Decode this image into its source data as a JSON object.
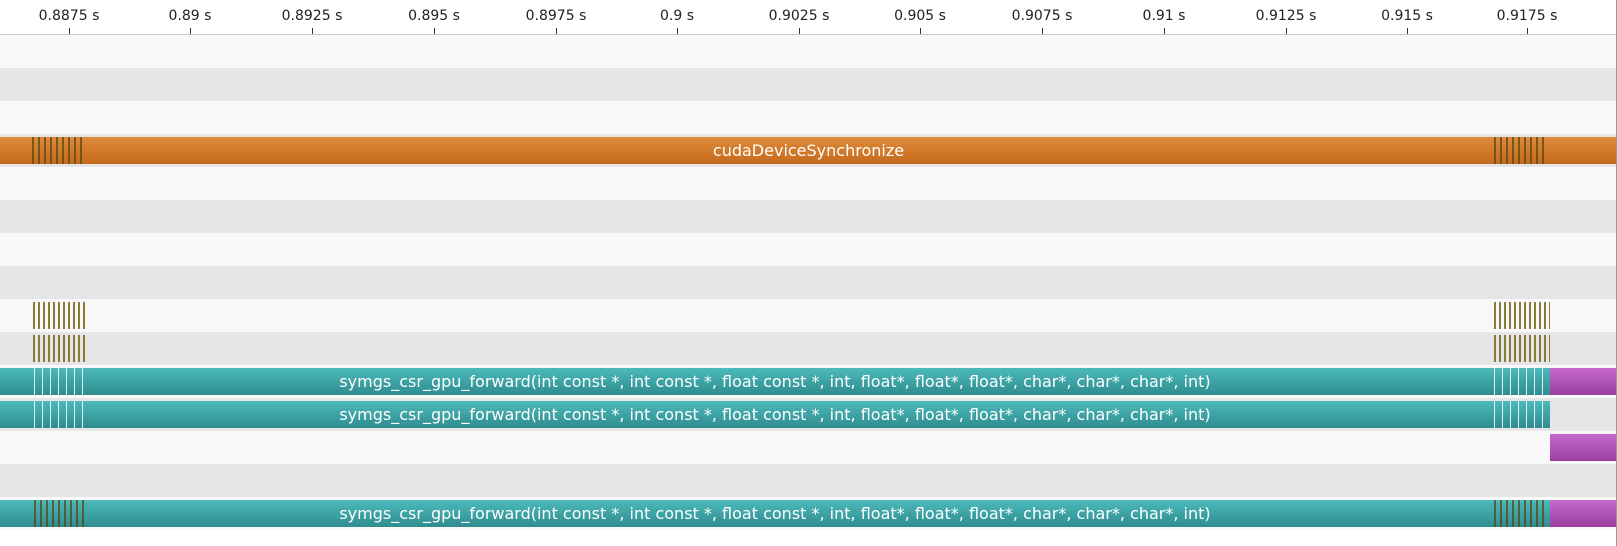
{
  "ruler": {
    "ticks": [
      "0.8875 s",
      "0.89 s",
      "0.8925 s",
      "0.895 s",
      "0.8975 s",
      "0.9 s",
      "0.9025 s",
      "0.905 s",
      "0.9075 s",
      "0.91 s",
      "0.9125 s",
      "0.915 s",
      "0.9175 s"
    ]
  },
  "timeline": {
    "sync_label": "cudaDeviceSynchronize",
    "kernel_label_1": "symgs_csr_gpu_forward(int const *, int const *, float const *, int, float*, float*, float*, char*, char*, char*, int)",
    "kernel_label_2": "symgs_csr_gpu_forward(int const *, int const *, float const *, int, float*, float*, float*, char*, char*, char*, int)",
    "kernel_label_3": "symgs_csr_gpu_forward(int const *, int const *, float const *, int, float*, float*, float*, char*, char*, char*, int)"
  },
  "colors": {
    "sync": "#c97020",
    "kernel": "#3aa3a5",
    "memcpy": "#b050b8",
    "marks": "#8a7a3a"
  }
}
